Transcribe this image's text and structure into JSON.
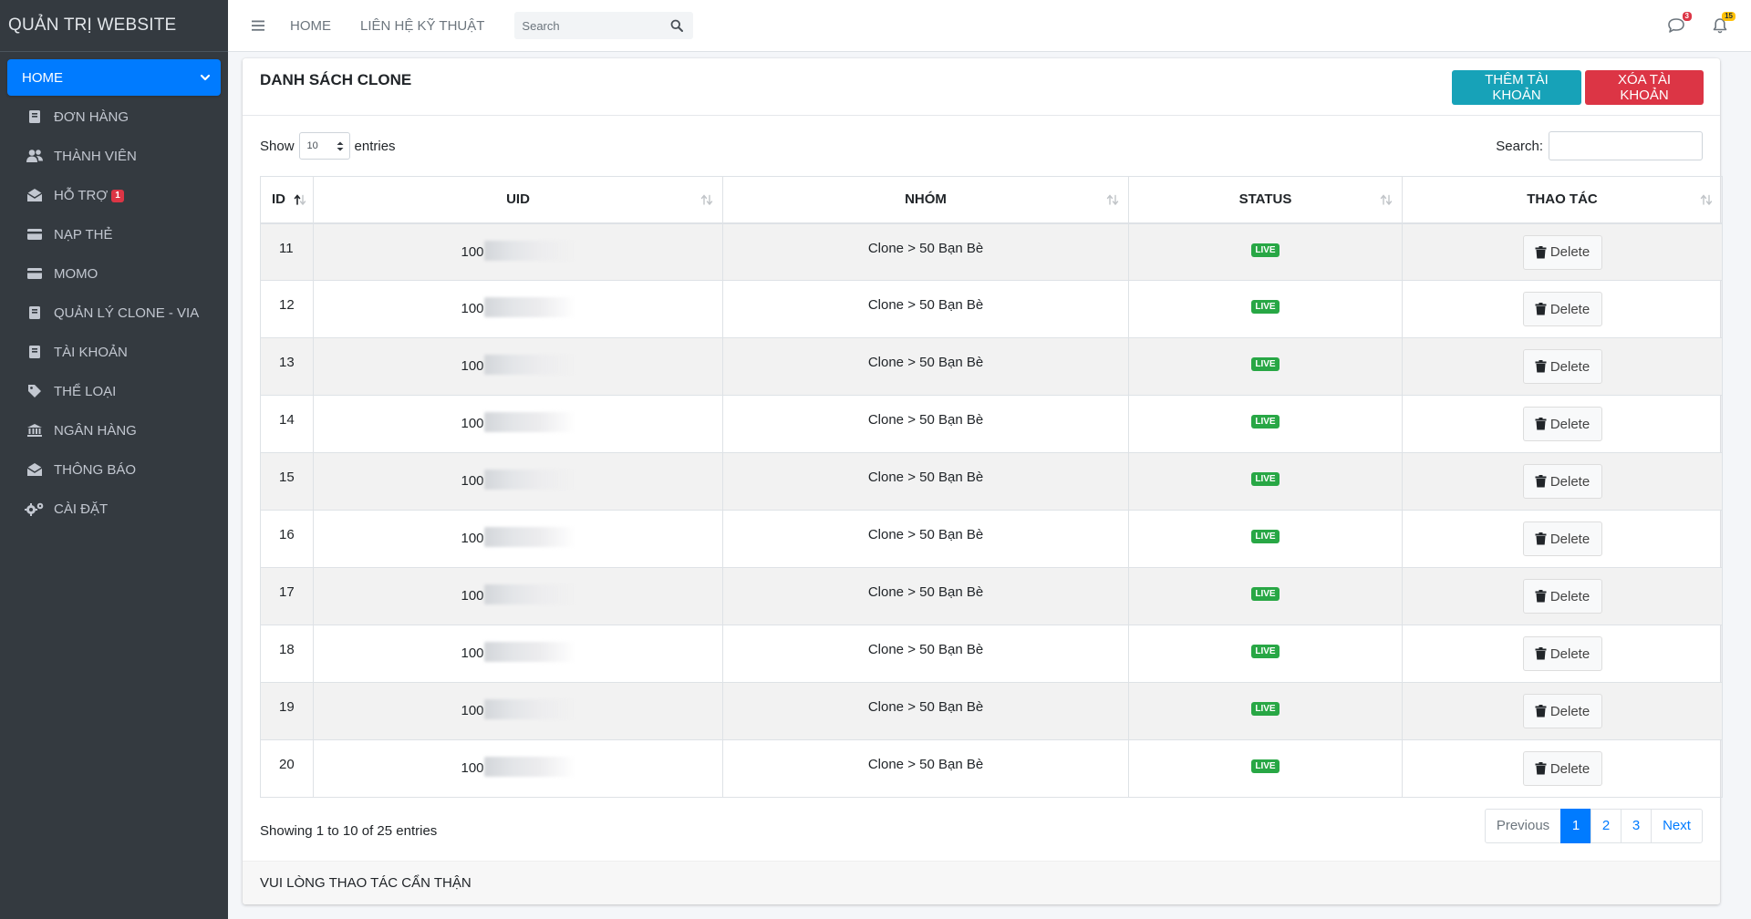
{
  "sidebar": {
    "brand": "QUẢN TRỊ WEBSITE",
    "items": [
      {
        "label": "HOME",
        "icon": "chevron-down-icon"
      },
      {
        "label": "ĐƠN HÀNG",
        "icon": "book-icon"
      },
      {
        "label": "THÀNH VIÊN",
        "icon": "users-icon"
      },
      {
        "label": "HỖ TRỢ",
        "icon": "envelope-open-icon",
        "badge": "1"
      },
      {
        "label": "NẠP THẺ",
        "icon": "credit-card-icon"
      },
      {
        "label": "MOMO",
        "icon": "wallet-icon"
      },
      {
        "label": "QUẢN LÝ CLONE - VIA",
        "icon": "book-icon"
      },
      {
        "label": "TÀI KHOẢN",
        "icon": "book-icon"
      },
      {
        "label": "THỂ LOẠI",
        "icon": "tag-icon"
      },
      {
        "label": "NGÂN HÀNG",
        "icon": "bank-icon"
      },
      {
        "label": "THÔNG BÁO",
        "icon": "envelope-open-icon"
      },
      {
        "label": "CÀI ĐẶT",
        "icon": "gears-icon"
      }
    ]
  },
  "topbar": {
    "links": [
      "HOME",
      "LIÊN HỆ KỸ THUẬT"
    ],
    "search_placeholder": "Search",
    "messages_badge": "3",
    "notifications_badge": "15"
  },
  "card": {
    "title": "DANH SÁCH CLONE",
    "add_button": "THÊM TÀI KHOẢN",
    "delete_all_button": "XÓA TÀI KHOẢN",
    "footer": "VUI LÒNG THAO TÁC CẨN THẬN"
  },
  "datatable": {
    "show_label": "Show",
    "page_length": "10",
    "entries_label": "entries",
    "search_label": "Search:",
    "columns": [
      "ID",
      "UID",
      "NHÓM",
      "STATUS",
      "THAO TÁC"
    ],
    "rows": [
      {
        "id": "11",
        "uid": "100",
        "group": "Clone > 50 Bạn Bè",
        "status": "LIVE",
        "action": "Delete"
      },
      {
        "id": "12",
        "uid": "100",
        "group": "Clone > 50 Bạn Bè",
        "status": "LIVE",
        "action": "Delete"
      },
      {
        "id": "13",
        "uid": "100",
        "group": "Clone > 50 Bạn Bè",
        "status": "LIVE",
        "action": "Delete"
      },
      {
        "id": "14",
        "uid": "100",
        "group": "Clone > 50 Bạn Bè",
        "status": "LIVE",
        "action": "Delete"
      },
      {
        "id": "15",
        "uid": "100",
        "group": "Clone > 50 Bạn Bè",
        "status": "LIVE",
        "action": "Delete"
      },
      {
        "id": "16",
        "uid": "100",
        "group": "Clone > 50 Bạn Bè",
        "status": "LIVE",
        "action": "Delete"
      },
      {
        "id": "17",
        "uid": "100",
        "group": "Clone > 50 Bạn Bè",
        "status": "LIVE",
        "action": "Delete"
      },
      {
        "id": "18",
        "uid": "100",
        "group": "Clone > 50 Bạn Bè",
        "status": "LIVE",
        "action": "Delete"
      },
      {
        "id": "19",
        "uid": "100",
        "group": "Clone > 50 Bạn Bè",
        "status": "LIVE",
        "action": "Delete"
      },
      {
        "id": "20",
        "uid": "100",
        "group": "Clone > 50 Bạn Bè",
        "status": "LIVE",
        "action": "Delete"
      }
    ],
    "info": "Showing 1 to 10 of 25 entries",
    "pagination": {
      "previous": "Previous",
      "pages": [
        "1",
        "2",
        "3"
      ],
      "active_page": "1",
      "next": "Next"
    }
  },
  "colors": {
    "sidebar_bg": "#343a40",
    "primary": "#007bff",
    "info": "#17a2b8",
    "danger": "#dc3545",
    "success": "#28a745",
    "warning": "#ffc107"
  }
}
